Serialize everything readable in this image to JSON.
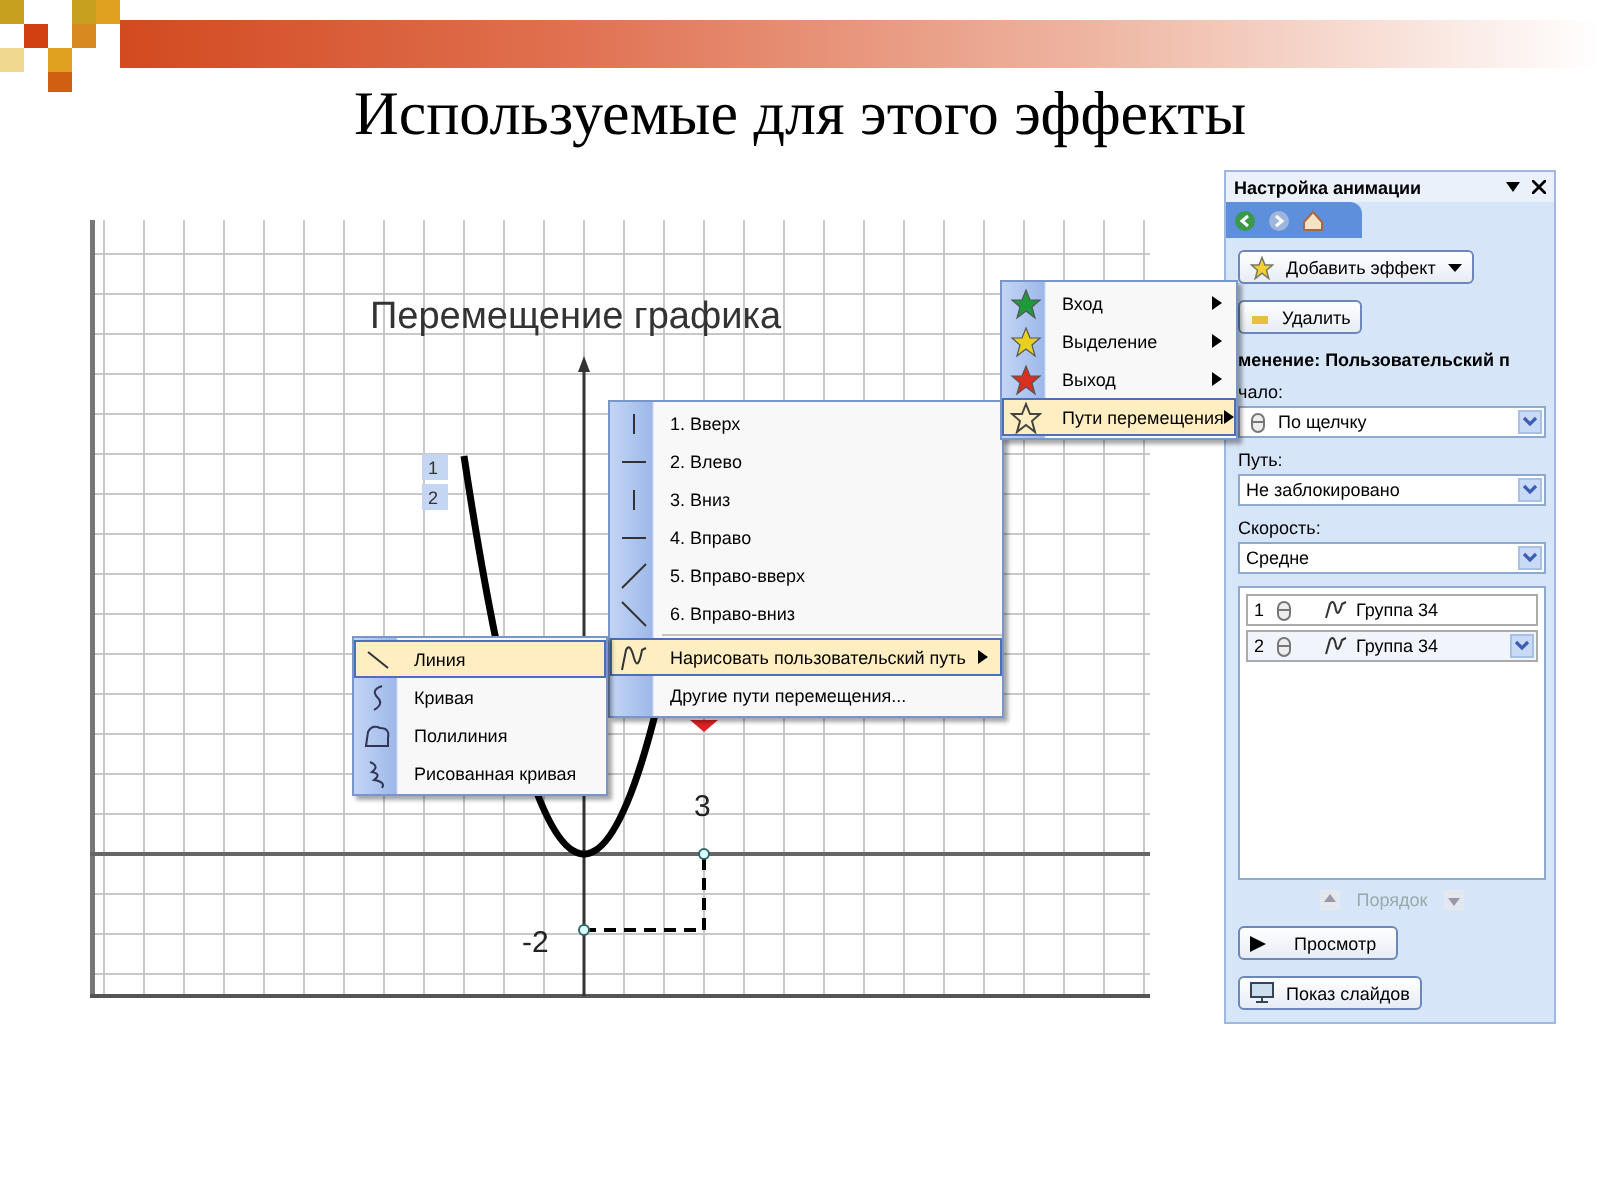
{
  "slide": {
    "title": "Используемые для этого эффекты"
  },
  "graph": {
    "title": "Перемещение графика",
    "labels": [
      "3",
      "-2"
    ],
    "tags": [
      "1",
      "2"
    ]
  },
  "path_menu": {
    "items": [
      {
        "kind": "vertical",
        "label": "1. Вверх",
        "selected": false,
        "submenu": false
      },
      {
        "kind": "horizontal",
        "label": "2. Влево",
        "selected": false,
        "submenu": false
      },
      {
        "kind": "vertical",
        "label": "3. Вниз",
        "selected": false,
        "submenu": false
      },
      {
        "kind": "horizontal",
        "label": "4. Вправо",
        "selected": false,
        "submenu": false
      },
      {
        "kind": "rising",
        "label": "5. Вправо-вверх",
        "selected": false,
        "submenu": false
      },
      {
        "kind": "falling",
        "label": "6. Вправо-вниз",
        "selected": false,
        "submenu": false
      },
      {
        "kind": "custom",
        "label": "Нарисовать пользовательский путь",
        "selected": true,
        "submenu": true
      },
      {
        "kind": "none",
        "label": "Другие пути перемещения...",
        "selected": false,
        "submenu": false
      }
    ]
  },
  "draw_menu": {
    "items": [
      {
        "kind": "line",
        "label": "Линия",
        "selected": true
      },
      {
        "kind": "curve",
        "label": "Кривая",
        "selected": false
      },
      {
        "kind": "polyline",
        "label": "Полилиния",
        "selected": false
      },
      {
        "kind": "scribble",
        "label": "Рисованная кривая",
        "selected": false
      }
    ]
  },
  "effect_menu": {
    "items": [
      {
        "kind": "star",
        "color": "#1e9a3c",
        "label": "Вход",
        "selected": false
      },
      {
        "kind": "star",
        "color": "#e8d020",
        "label": "Выделение",
        "selected": false
      },
      {
        "kind": "star",
        "color": "#d83020",
        "label": "Выход",
        "selected": false
      },
      {
        "kind": "outline",
        "label": "Пути перемещения",
        "selected": true
      }
    ]
  },
  "task_pane": {
    "title": "Настройка анимации",
    "add_button": "Добавить эффект",
    "remove_button": "Удалить",
    "effect_heading": "менение: Пользовательский п",
    "start_label": "чало:",
    "start_value": "По щелчку",
    "path_label": "Путь:",
    "path_value": "Не заблокировано",
    "speed_label": "Скорость:",
    "speed_value": "Средне",
    "effects": [
      {
        "number": "1",
        "name": "Группа 34",
        "selected": false
      },
      {
        "number": "2",
        "name": "Группа 34",
        "selected": true
      }
    ],
    "order_label": "Порядок",
    "play_button": "Просмотр",
    "slideshow_button": "Показ слайдов"
  }
}
